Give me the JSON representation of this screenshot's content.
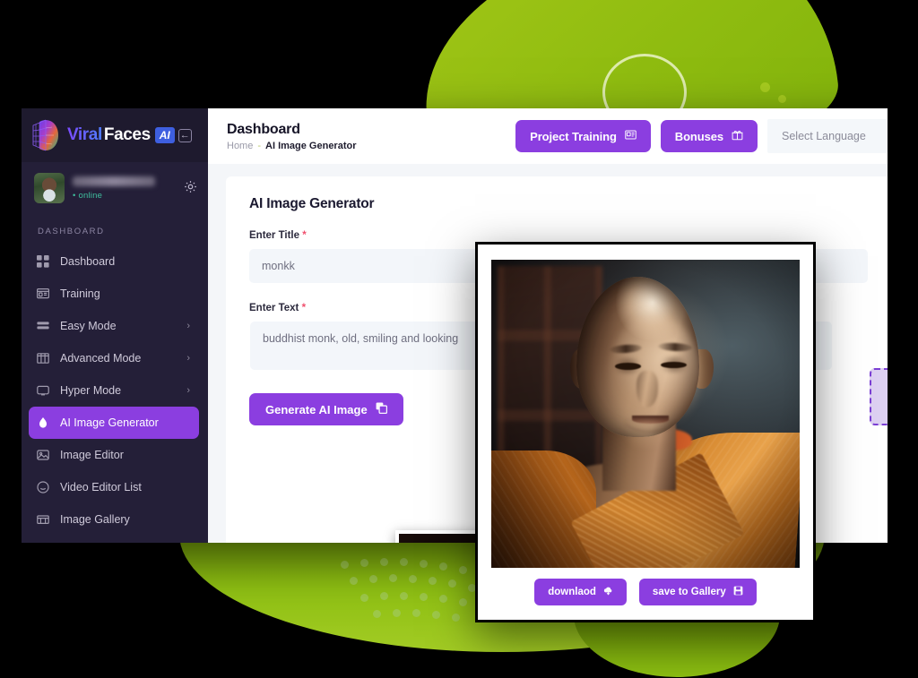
{
  "brand": {
    "name_part1": "Viral",
    "name_part2": "Faces",
    "badge": "AI",
    "collapse_icon": "collapse-arrow-icon",
    "logo_icon": "face-wireframe-icon"
  },
  "sidebar": {
    "user": {
      "name_redacted": "",
      "status": "online",
      "avatar_icon": "user-avatar",
      "settings_icon": "gear-icon"
    },
    "section_heading": "DASHBOARD",
    "items": [
      {
        "label": "Dashboard",
        "icon": "grid-icon",
        "has_caret": false,
        "active": false
      },
      {
        "label": "Training",
        "icon": "board-icon",
        "has_caret": false,
        "active": false
      },
      {
        "label": "Easy Mode",
        "icon": "rows-icon",
        "has_caret": true,
        "active": false
      },
      {
        "label": "Advanced Mode",
        "icon": "columns-icon",
        "has_caret": true,
        "active": false
      },
      {
        "label": "Hyper Mode",
        "icon": "monitor-icon",
        "has_caret": true,
        "active": false
      },
      {
        "label": "AI Image Generator",
        "icon": "droplet-icon",
        "has_caret": false,
        "active": true
      },
      {
        "label": "Image Editor",
        "icon": "photo-icon",
        "has_caret": false,
        "active": false
      },
      {
        "label": "Video Editor List",
        "icon": "smiley-icon",
        "has_caret": false,
        "active": false
      },
      {
        "label": "Image Gallery",
        "icon": "gallery-icon",
        "has_caret": false,
        "active": false
      }
    ],
    "caret_glyph": "›"
  },
  "topbar": {
    "title": "Dashboard",
    "breadcrumb": {
      "home": "Home",
      "separator": "-",
      "current": "AI Image Generator"
    },
    "project_training_label": "Project Training",
    "project_training_icon": "training-card-icon",
    "bonuses_label": "Bonuses",
    "bonuses_icon": "gift-icon",
    "language_label": "Select Language"
  },
  "content": {
    "card_title": "AI Image Generator",
    "title_field": {
      "label": "Enter Title",
      "required_marker": "*",
      "value": "monkk"
    },
    "text_field": {
      "label": "Enter Text",
      "required_marker": "*",
      "value": "buddhist monk, old, smiling and looking"
    },
    "generate_label": "Generate AI Image",
    "generate_icon": "copy-icon"
  },
  "modal": {
    "image_alt": "generated-monk-portrait",
    "download_label": "downlaod",
    "download_icon": "download-cloud-icon",
    "save_label": "save to Gallery",
    "save_icon": "save-floppy-icon"
  },
  "colors": {
    "accent_purple": "#8b3ee0",
    "sidebar_bg": "#241f38",
    "accent_green": "#8fbc10",
    "required_red": "#f0506e",
    "online_green": "#3fbf9e"
  }
}
